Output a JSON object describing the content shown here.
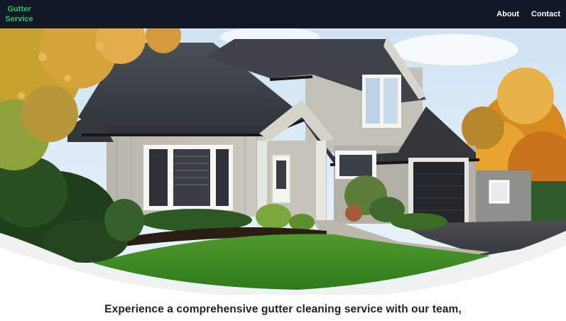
{
  "navbar": {
    "brand_line1": "Gutter",
    "brand_line2": "Service",
    "links": [
      {
        "label": "About"
      },
      {
        "label": "Contact"
      }
    ]
  },
  "hero": {
    "image_subject": "house-exterior-with-lawn"
  },
  "main": {
    "tagline": "Experience a comprehensive gutter cleaning service with our team,"
  },
  "colors": {
    "navbar_bg": "#111827",
    "brand": "#22c55e",
    "nav_text": "#ffffff",
    "body_text": "#1f2328"
  }
}
